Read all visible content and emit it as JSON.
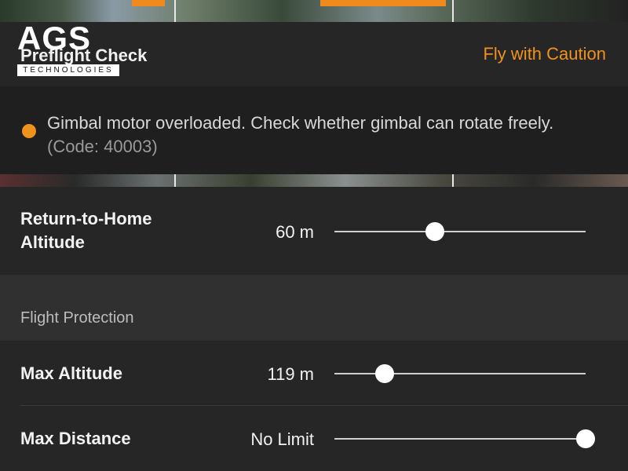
{
  "header": {
    "title": "Preflight Check",
    "status": "Fly with Caution"
  },
  "logo": {
    "mark": "AGS",
    "subtitle": "TECHNOLOGIES"
  },
  "warning": {
    "message": "Gimbal motor overloaded. Check whether gimbal can rotate freely.",
    "code": "(Code: 40003)"
  },
  "settings": {
    "return_to_home": {
      "label_line1": "Return-to-Home",
      "label_line2": "Altitude",
      "value": "60 m",
      "level": 0.4
    },
    "section_title": "Flight Protection",
    "max_altitude": {
      "label": "Max Altitude",
      "value": "119 m",
      "level": 0.2
    },
    "max_distance": {
      "label": "Max Distance",
      "value": "No Limit",
      "level": 1.0
    }
  },
  "colors": {
    "accent": "#f0921e",
    "background": "#262626",
    "text": "#f2f2f2"
  }
}
